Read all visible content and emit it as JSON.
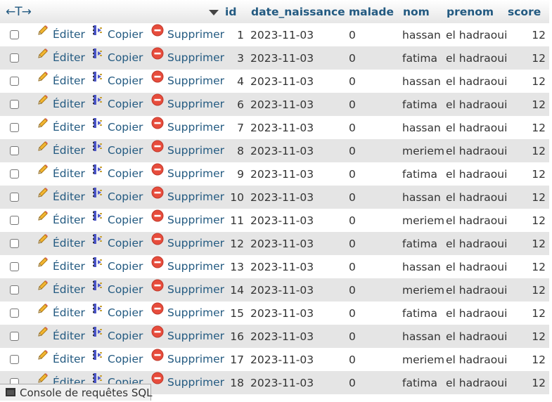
{
  "columns": {
    "resize_glyph": "←T→",
    "id": "id",
    "date_naissance": "date_naissance",
    "malade": "malade",
    "nom": "nom",
    "prenom": "prenom",
    "score": "score"
  },
  "actions": {
    "edit": "Éditer",
    "copy": "Copier",
    "delete": "Supprimer"
  },
  "rows": [
    {
      "id": "1",
      "date_naissance": "2023-11-03",
      "malade": "0",
      "nom": "hassan",
      "prenom": "el hadraoui",
      "score": "12"
    },
    {
      "id": "3",
      "date_naissance": "2023-11-03",
      "malade": "0",
      "nom": "fatima",
      "prenom": "el hadraoui",
      "score": "12"
    },
    {
      "id": "4",
      "date_naissance": "2023-11-03",
      "malade": "0",
      "nom": "hassan",
      "prenom": "el hadraoui",
      "score": "12"
    },
    {
      "id": "6",
      "date_naissance": "2023-11-03",
      "malade": "0",
      "nom": "fatima",
      "prenom": "el hadraoui",
      "score": "12"
    },
    {
      "id": "7",
      "date_naissance": "2023-11-03",
      "malade": "0",
      "nom": "hassan",
      "prenom": "el hadraoui",
      "score": "12"
    },
    {
      "id": "8",
      "date_naissance": "2023-11-03",
      "malade": "0",
      "nom": "meriem",
      "prenom": "el hadraoui",
      "score": "12"
    },
    {
      "id": "9",
      "date_naissance": "2023-11-03",
      "malade": "0",
      "nom": "fatima",
      "prenom": "el hadraoui",
      "score": "12"
    },
    {
      "id": "10",
      "date_naissance": "2023-11-03",
      "malade": "0",
      "nom": "hassan",
      "prenom": "el hadraoui",
      "score": "12"
    },
    {
      "id": "11",
      "date_naissance": "2023-11-03",
      "malade": "0",
      "nom": "meriem",
      "prenom": "el hadraoui",
      "score": "12"
    },
    {
      "id": "12",
      "date_naissance": "2023-11-03",
      "malade": "0",
      "nom": "fatima",
      "prenom": "el hadraoui",
      "score": "12"
    },
    {
      "id": "13",
      "date_naissance": "2023-11-03",
      "malade": "0",
      "nom": "hassan",
      "prenom": "el hadraoui",
      "score": "12"
    },
    {
      "id": "14",
      "date_naissance": "2023-11-03",
      "malade": "0",
      "nom": "meriem",
      "prenom": "el hadraoui",
      "score": "12"
    },
    {
      "id": "15",
      "date_naissance": "2023-11-03",
      "malade": "0",
      "nom": "fatima",
      "prenom": "el hadraoui",
      "score": "12"
    },
    {
      "id": "16",
      "date_naissance": "2023-11-03",
      "malade": "0",
      "nom": "hassan",
      "prenom": "el hadraoui",
      "score": "12"
    },
    {
      "id": "17",
      "date_naissance": "2023-11-03",
      "malade": "0",
      "nom": "meriem",
      "prenom": "el hadraoui",
      "score": "12"
    },
    {
      "id": "18",
      "date_naissance": "2023-11-03",
      "malade": "0",
      "nom": "fatima",
      "prenom": "el hadraoui",
      "score": "12"
    }
  ],
  "console": {
    "label": "Console de requêtes SQL"
  },
  "colors": {
    "link": "#235a81",
    "row_alt": "#e5e5e5",
    "delete_icon": "#e74c3c",
    "copy_icon": "#4b55c8"
  },
  "icons": {
    "edit": "pencil-icon",
    "copy": "copy-icon",
    "delete": "delete-icon",
    "console": "console-icon",
    "sort": "sort-down-icon"
  }
}
